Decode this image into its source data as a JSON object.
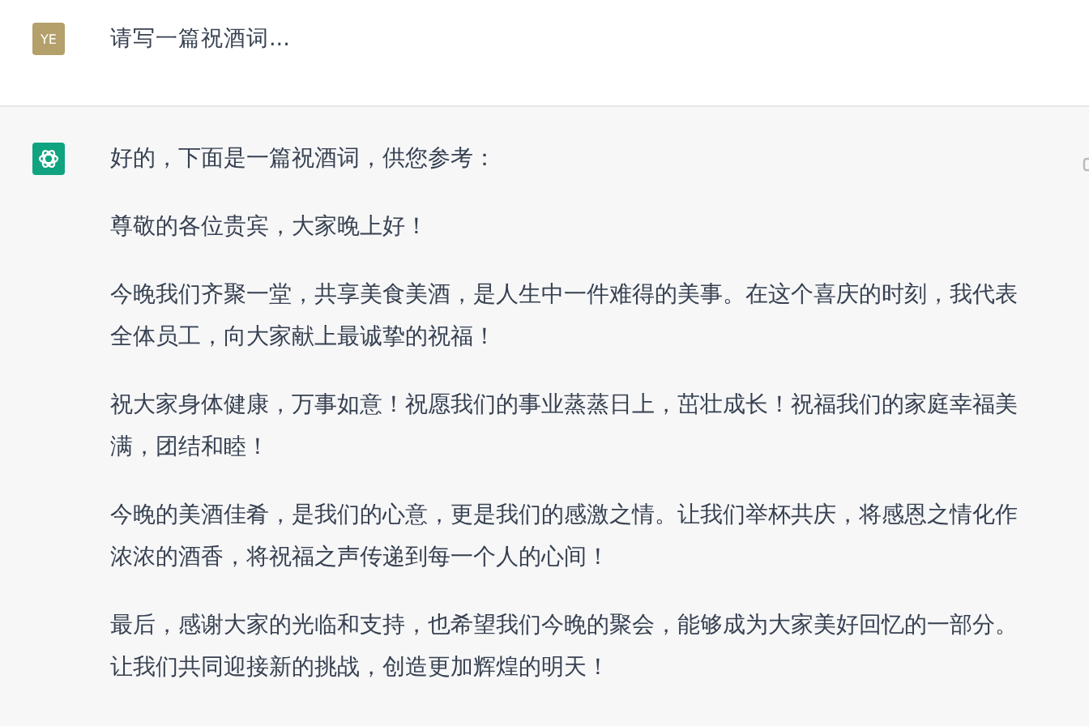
{
  "user_message": {
    "avatar": "YE",
    "text": "请写一篇祝酒词..."
  },
  "assistant_message": {
    "paragraphs": [
      {
        "lines": [
          "好的，下面是一篇祝酒词，供您参考："
        ]
      },
      {
        "lines": [
          "尊敬的各位贵宾，大家晚上好！"
        ]
      },
      {
        "lines": [
          "今晚我们齐聚一堂，共享美食美酒，是人生中一件难得的美事。在这个喜庆的时刻，我代表",
          "全体员工，向大家献上最诚挚的祝福！"
        ]
      },
      {
        "lines": [
          "祝大家身体健康，万事如意！祝愿我们的事业蒸蒸日上，茁壮成长！祝福我们的家庭幸福美",
          "满，团结和睦！"
        ]
      },
      {
        "lines": [
          "今晚的美酒佳肴，是我们的心意，更是我们的感激之情。让我们举杯共庆，将感恩之情化作",
          "浓浓的酒香，将祝福之声传递到每一个人的心间！"
        ]
      },
      {
        "lines": [
          "最后，感谢大家的光临和支持，也希望我们今晚的聚会，能够成为大家美好回忆的一部分。",
          "让我们共同迎接新的挑战，创造更加辉煌的明天！"
        ]
      }
    ]
  }
}
